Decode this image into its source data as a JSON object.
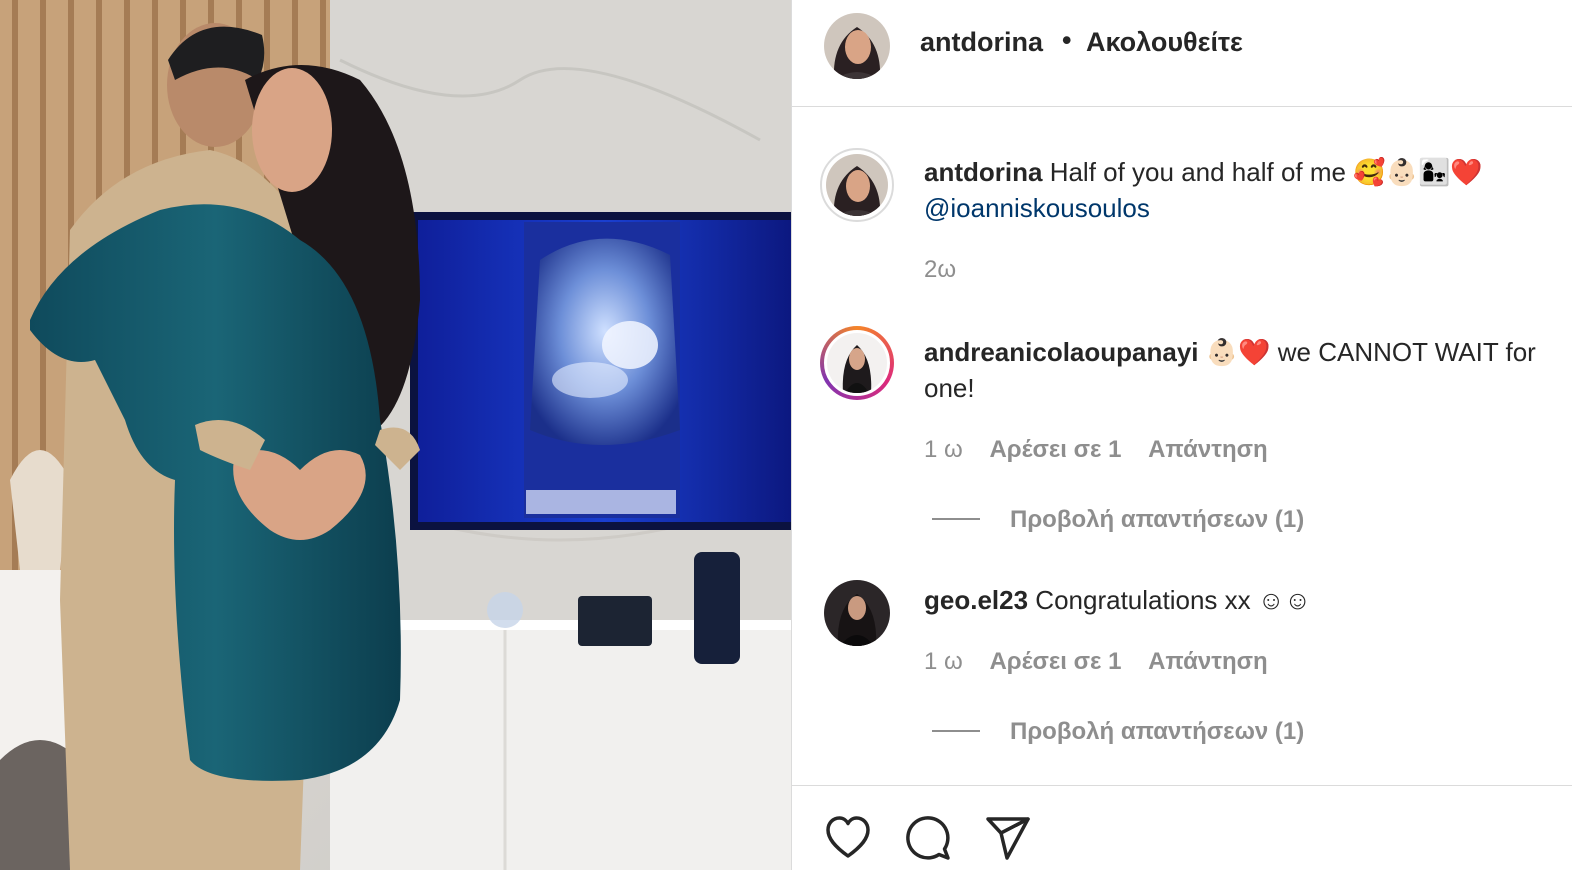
{
  "header": {
    "username": "antdorina",
    "separator": "•",
    "follow_status": "Ακολουθείτε"
  },
  "caption": {
    "username": "antdorina",
    "text": "Half of you and half of me 🥰👶🏻👩‍👧❤️",
    "mention": "@ioanniskousoulos",
    "time": "2ω"
  },
  "comments": [
    {
      "username": "andreanicolaoupanayi",
      "text_line1": "👶🏻❤️ we CANNOT WAIT for",
      "text_line2": "one!",
      "time": "1 ω",
      "likes": "Αρέσει σε 1",
      "reply": "Απάντηση",
      "view_replies": "Προβολή απαντήσεων (1)"
    },
    {
      "username": "geo.el23",
      "text_line1": "Congratulations xx ☺☺",
      "time": "1 ω",
      "likes": "Αρέσει σε 1",
      "reply": "Απάντηση",
      "view_replies": "Προβολή απαντήσεων (1)"
    }
  ],
  "icons": [
    "heart-icon",
    "comment-icon",
    "share-icon"
  ],
  "colors": {
    "text": "#262626",
    "secondary": "#8e8e8e",
    "mention": "#00376b",
    "border": "#dbdbdb",
    "ultrasound": "#1a3fd0"
  }
}
